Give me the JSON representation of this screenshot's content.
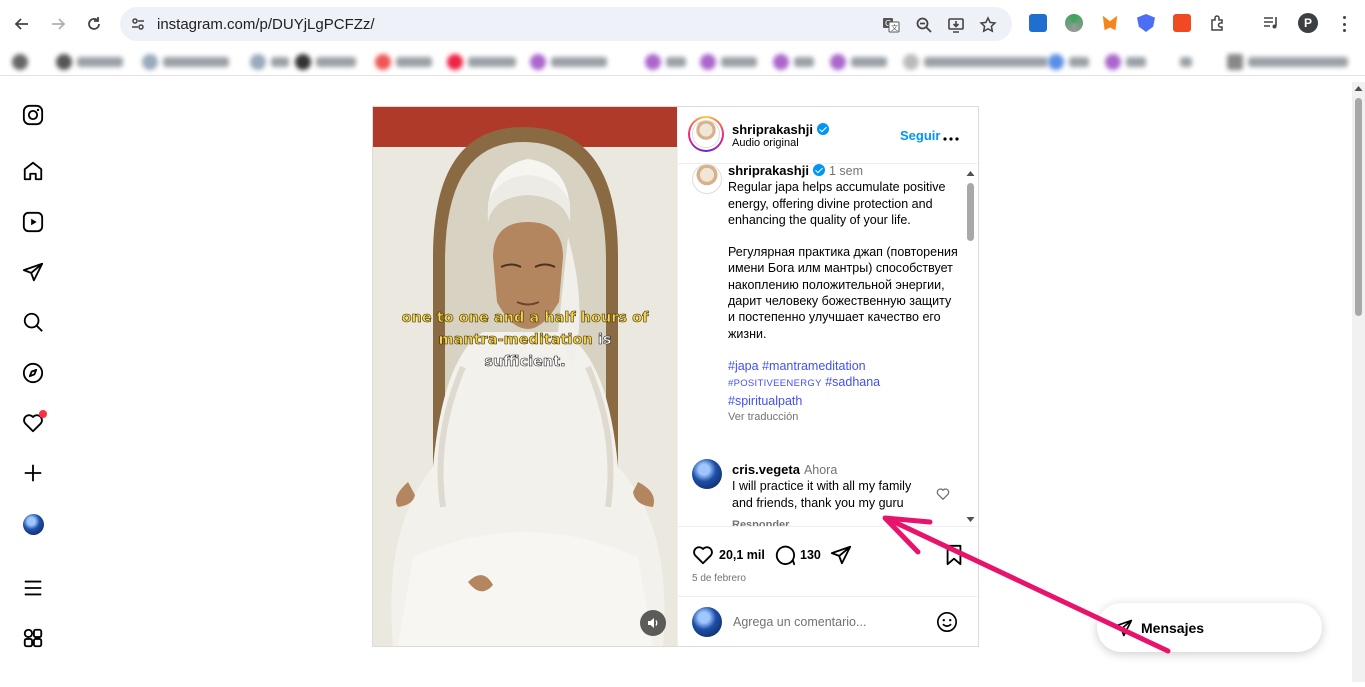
{
  "browser": {
    "url": "instagram.com/p/DUYjLgPCFZz/",
    "profile_initial": "P"
  },
  "sidebar": {
    "items": [
      "instagram-logo",
      "home",
      "reels",
      "messages",
      "search",
      "explore",
      "notifications",
      "create",
      "profile",
      "more",
      "also-from-meta"
    ]
  },
  "post": {
    "author": "shriprakashji",
    "subtitle": "Audio original",
    "follow_label": "Seguir",
    "more_label": "•••",
    "overlay_line1": "one to one and a half hours of",
    "overlay_line2_yellow": "mantra-meditation",
    "overlay_line2_white": " is",
    "overlay_line3": "sufficient.",
    "caption": {
      "author": "shriprakashji",
      "time": "1 sem",
      "text_en": "Regular japa helps accumulate positive energy, offering divine protection and enhancing the quality of your life.",
      "text_ru": "Регулярная практика джап (повторения имени Бога илм мантры) способствует накоплению положительной энергии, дарит человеку божественную защиту и постепенно улучшает качество его жизни.",
      "tag1": "#japa",
      "tag2": "#mantrameditation",
      "tag3": "#POSITIVEENERGY",
      "tag4": "#sadhana",
      "tag5": "#spiritualpath",
      "see_translation": "Ver traducción"
    },
    "comment": {
      "author": "cris.vegeta",
      "time": "Ahora",
      "text": "I will practice it with all my family and friends, thank you my guru",
      "reply_label": "Responder"
    },
    "likes": "20,1 mil",
    "comments_count": "130",
    "date": "5 de febrero",
    "add_comment_placeholder": "Agrega un comentario..."
  },
  "messages_pill": {
    "label": "Mensajes"
  },
  "colors": {
    "accent": "#0095f6",
    "hashtag": "#4150f7",
    "annotation_arrow": "#e8146c",
    "notification_dot": "#ff3040"
  }
}
